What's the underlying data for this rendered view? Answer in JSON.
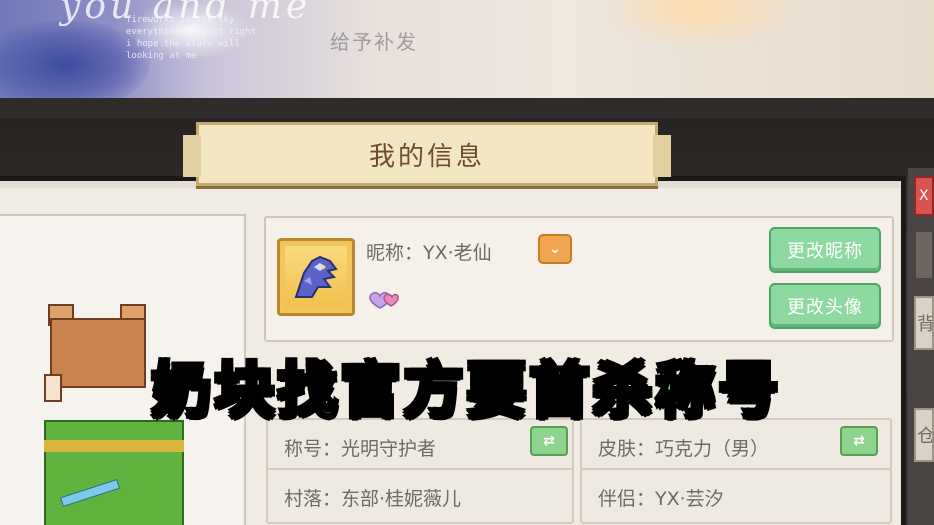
{
  "banner": {
    "script_text": "you and me",
    "lines": [
      "fireworks in the sky",
      "everything is just right",
      "i hope the stars will",
      "looking at me"
    ],
    "stamp": "给予补发"
  },
  "panel": {
    "title": "我的信息"
  },
  "profile": {
    "nickname_label": "昵称：YX·老仙",
    "rename_button": "更改昵称",
    "change_avatar_button": "更改头像"
  },
  "info": {
    "title_label": "称号：光明守护者",
    "skin_label": "皮肤：巧克力（男）",
    "village_label": "村落：东部·桂妮薇儿",
    "partner_label": "伴侣：YX·芸汐"
  },
  "side_tabs": {
    "close": "X",
    "tab1": "背",
    "tab2": "仓"
  },
  "caption": {
    "text": "奶块找官方要首杀称号"
  },
  "colors": {
    "caption_green": "#4fe57b",
    "button_green": "#8dd9a0",
    "title_brown": "#6e4c2c"
  },
  "icons": [
    "dropdown-chevron-icon",
    "heart-gem-icon",
    "swap-arrows-icon",
    "dragon-avatar-icon"
  ]
}
